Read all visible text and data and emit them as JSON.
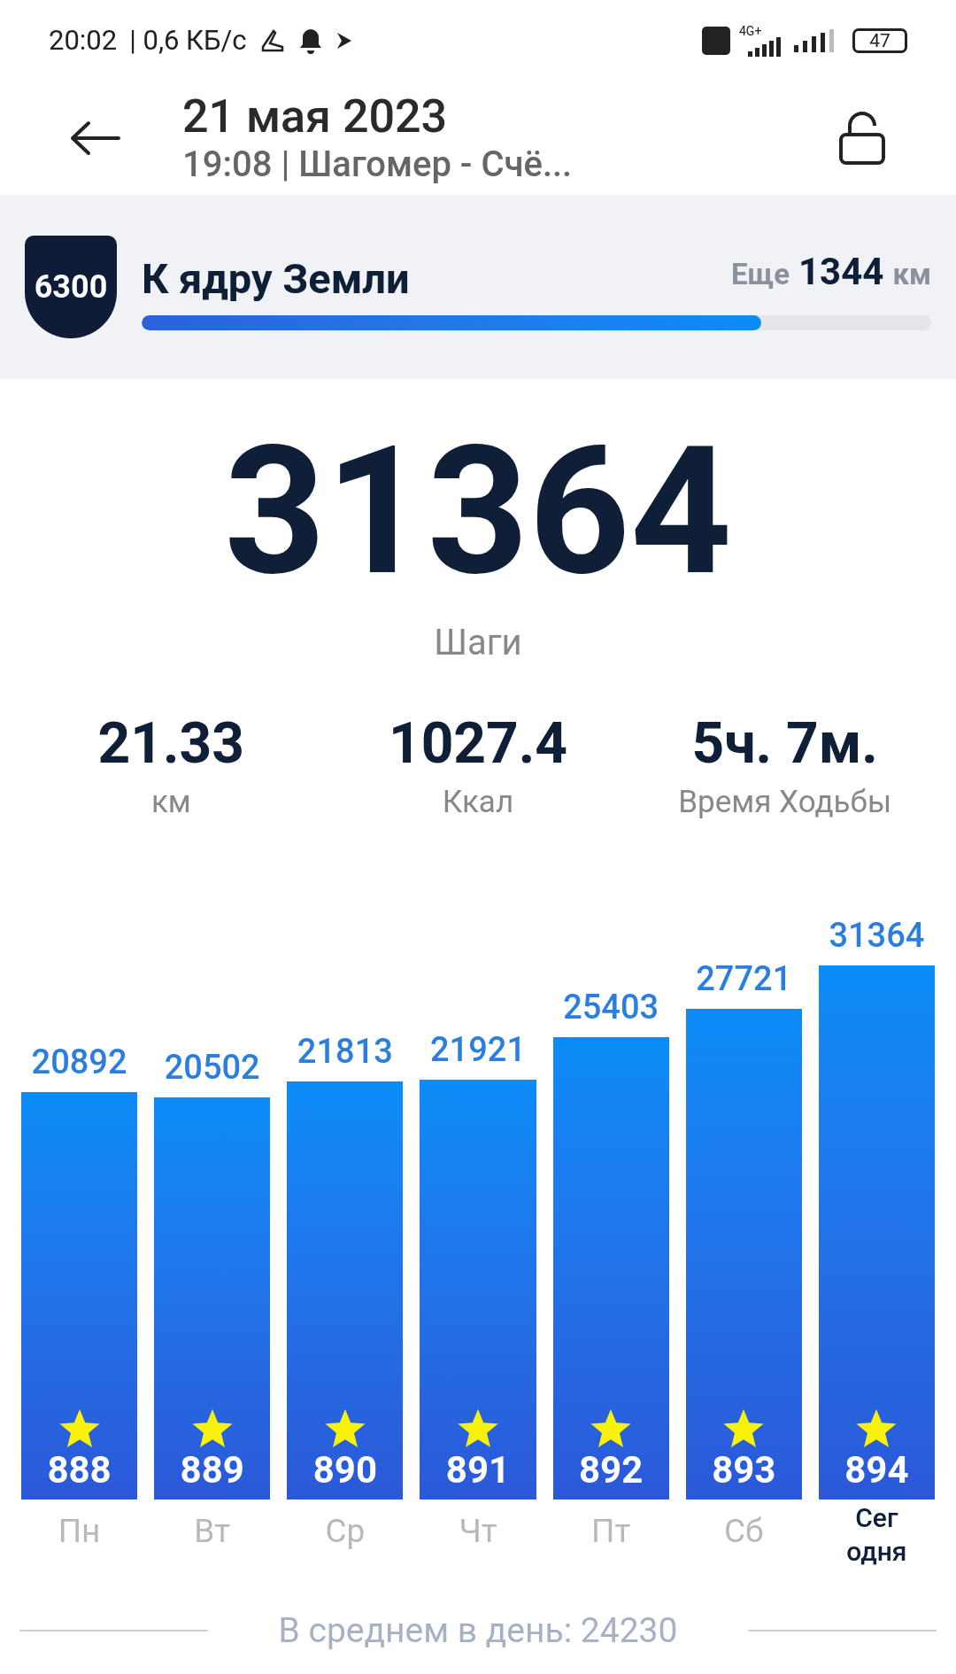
{
  "status_bar": {
    "time": "20:02",
    "speed": "| 0,6 КБ/с",
    "network": "4G+",
    "battery": "47"
  },
  "header": {
    "title": "21 мая 2023",
    "subtitle": "19:08 | Шагомер - Счё..."
  },
  "goal": {
    "badge": "6300",
    "title": "К ядру Земли",
    "remaining_prefix": "Еще",
    "remaining_value": "1344",
    "remaining_unit": "км",
    "level": 0.785
  },
  "steps": {
    "value": "31364",
    "label": "Шаги"
  },
  "stats": [
    {
      "value": "21.33",
      "label": "км"
    },
    {
      "value": "1027.4",
      "label": "Ккал"
    },
    {
      "value": "5ч. 7м.",
      "label": "Время Ходьбы"
    }
  ],
  "days": [
    {
      "value": "20892",
      "count": "888",
      "label": "Пн",
      "selected": false
    },
    {
      "value": "20502",
      "count": "889",
      "label": "Вт",
      "selected": false
    },
    {
      "value": "21813",
      "count": "890",
      "label": "Ср",
      "selected": false
    },
    {
      "value": "21921",
      "count": "891",
      "label": "Чт",
      "selected": false
    },
    {
      "value": "25403",
      "count": "892",
      "label": "Пт",
      "selected": false
    },
    {
      "value": "27721",
      "count": "893",
      "label": "Сб",
      "selected": false
    },
    {
      "value": "31364",
      "count": "894",
      "label": "Сег одня",
      "selected": true
    }
  ],
  "average": "В среднем в день: 24230"
}
